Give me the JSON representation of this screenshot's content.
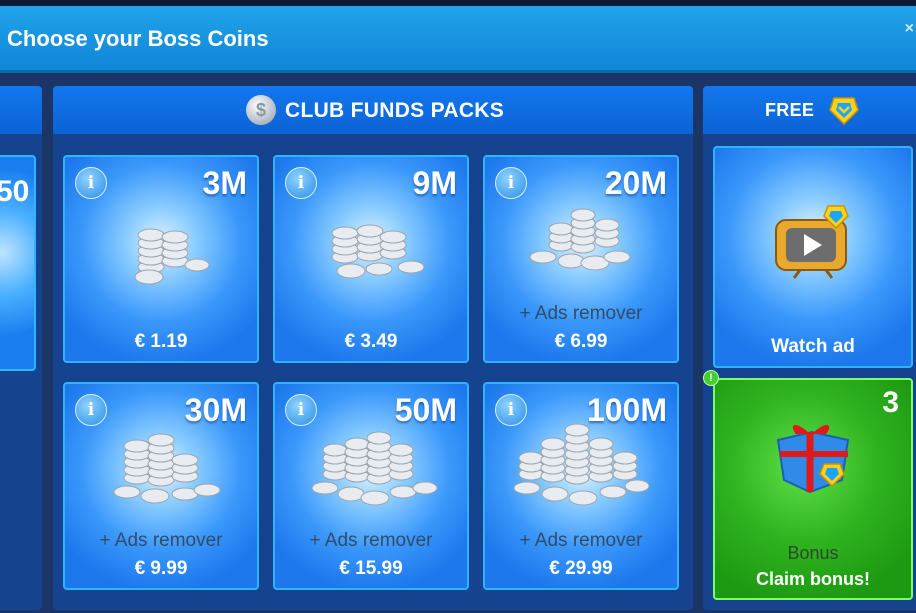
{
  "window": {
    "title": "Choose your Boss Coins",
    "close_label": "×"
  },
  "left_panel": {
    "partial_amount": "50"
  },
  "club_funds": {
    "title": "CLUB FUNDS PACKS",
    "icon": "silver-coin-icon",
    "packs": [
      {
        "amount": "3M",
        "extra": "",
        "price": "€ 1.19"
      },
      {
        "amount": "9M",
        "extra": "",
        "price": "€ 3.49"
      },
      {
        "amount": "20M",
        "extra": "+ Ads remover",
        "price": "€ 6.99"
      },
      {
        "amount": "30M",
        "extra": "+ Ads remover",
        "price": "€ 9.99"
      },
      {
        "amount": "50M",
        "extra": "+ Ads remover",
        "price": "€ 15.99"
      },
      {
        "amount": "100M",
        "extra": "+ Ads remover",
        "price": "€ 29.99"
      }
    ]
  },
  "free": {
    "title": "FREE",
    "watch_ad_label": "Watch ad",
    "bonus_count": "3",
    "bonus_label": "Bonus",
    "claim_label": "Claim bonus!",
    "alert": "!"
  },
  "colors": {
    "accent_blue": "#1377ee",
    "green": "#2fb21f",
    "title_bar": "#22a3ea"
  }
}
